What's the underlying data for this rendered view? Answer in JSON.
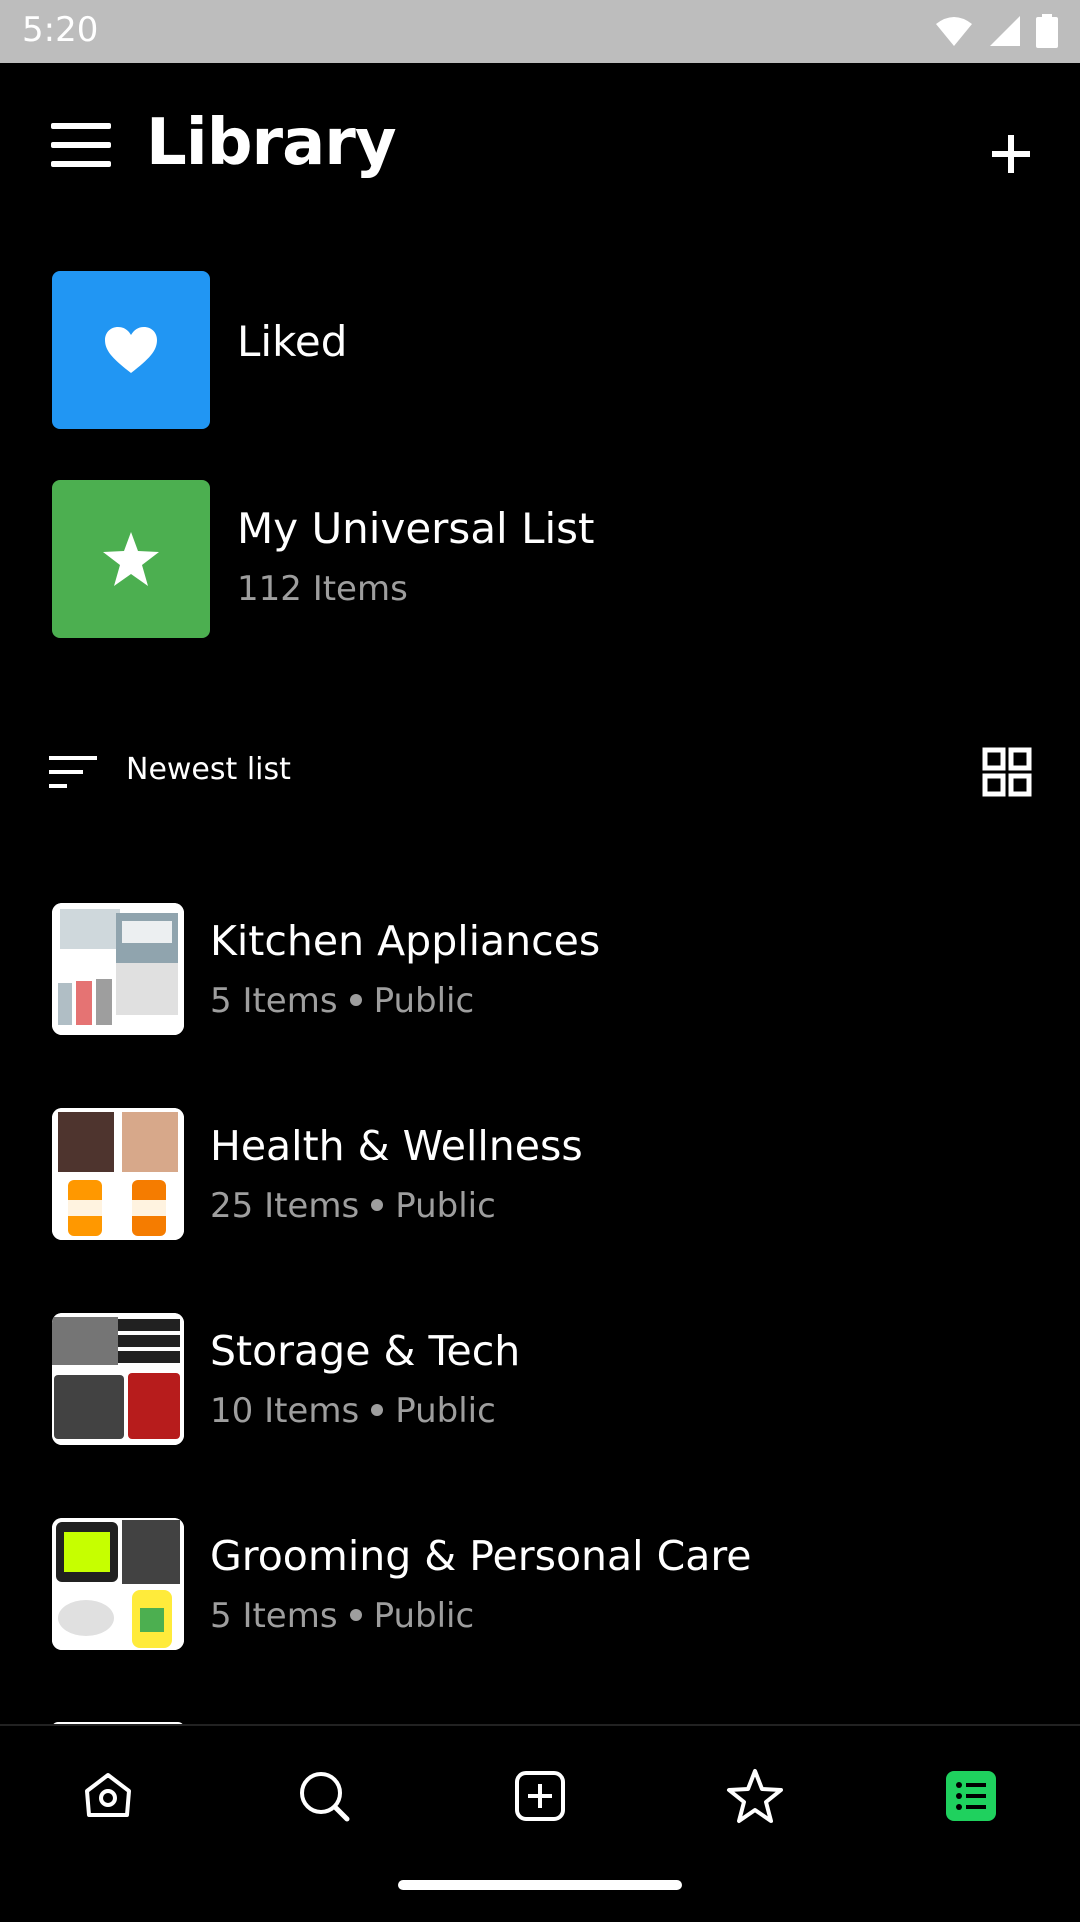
{
  "status_bar": {
    "time": "5:20"
  },
  "header": {
    "title": "Library"
  },
  "pinned": [
    {
      "name": "Liked",
      "sub": "",
      "color": "#2196f3",
      "icon": "heart-icon"
    },
    {
      "name": "My Universal List",
      "sub": "112 Items",
      "color": "#4caf50",
      "icon": "star-icon"
    }
  ],
  "sort": {
    "label": "Newest list"
  },
  "lists": [
    {
      "title": "Kitchen Appliances",
      "count": "5 Items",
      "visibility": "Public"
    },
    {
      "title": "Health & Wellness",
      "count": "25 Items",
      "visibility": "Public"
    },
    {
      "title": "Storage & Tech",
      "count": "10 Items",
      "visibility": "Public"
    },
    {
      "title": "Grooming & Personal Care",
      "count": "5 Items",
      "visibility": "Public"
    }
  ],
  "bottom_nav": [
    {
      "name": "home-icon",
      "active": false
    },
    {
      "name": "search-icon",
      "active": false
    },
    {
      "name": "add-box-icon",
      "active": false
    },
    {
      "name": "star-outline-icon",
      "active": false
    },
    {
      "name": "library-list-icon",
      "active": true
    }
  ],
  "colors": {
    "accent": "#1fd15e",
    "muted_text": "#9e9e9e"
  }
}
